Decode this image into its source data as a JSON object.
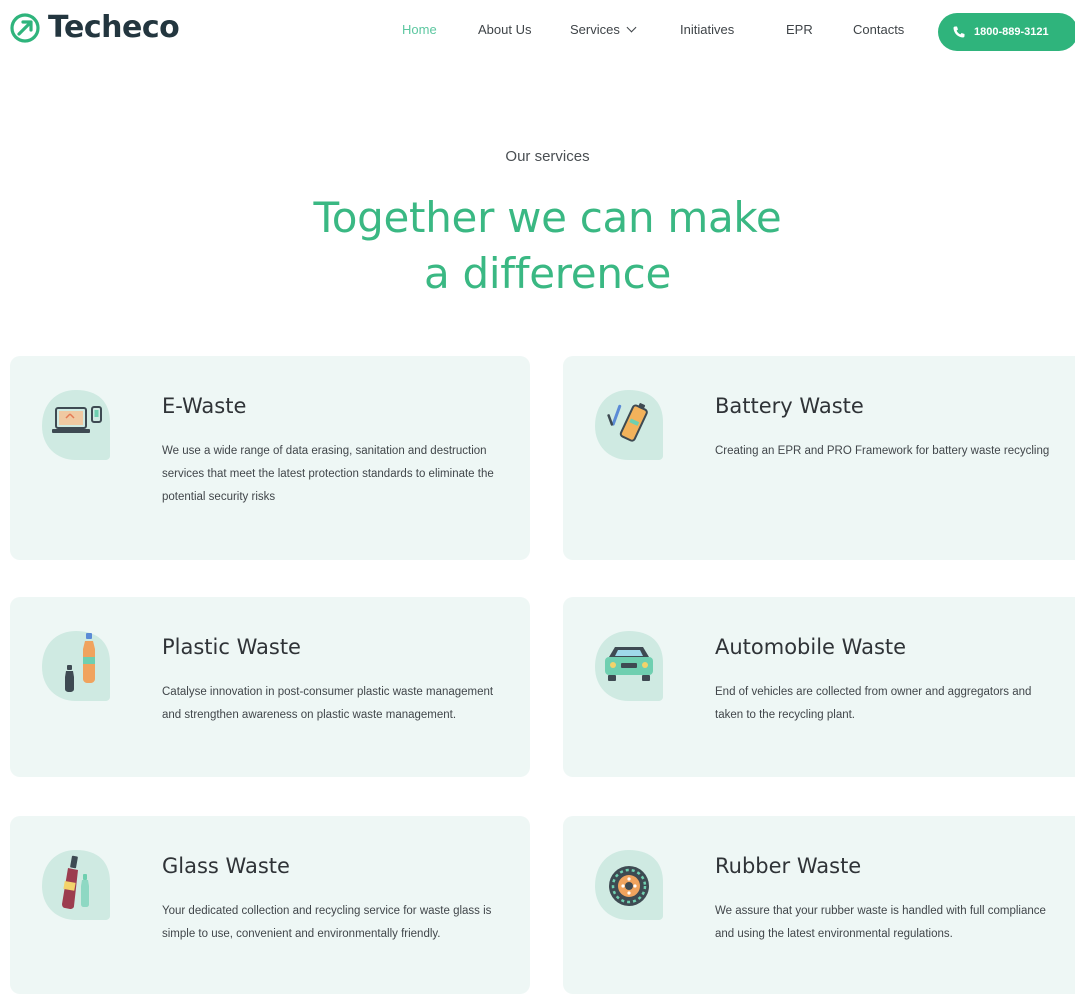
{
  "brand": {
    "name": "Techeco",
    "logo_icon": "recycle-arrow-logo",
    "color": "#2fb47c"
  },
  "nav": {
    "items": [
      {
        "label": "Home",
        "active": true
      },
      {
        "label": "About Us"
      },
      {
        "label": "Services",
        "has_dropdown": true
      },
      {
        "label": "Initiatives"
      },
      {
        "label": "EPR"
      },
      {
        "label": "Contacts"
      }
    ],
    "phone": {
      "label": "1800-889-3121",
      "icon": "phone-icon"
    }
  },
  "section": {
    "eyebrow": "Our services",
    "headline_line1": "Together we can make",
    "headline_line2": "a difference"
  },
  "services": [
    {
      "title": "E-Waste",
      "icon": "laptop-phone-icon",
      "description": "We use a wide range of data erasing, sanitation and destruction services that meet the latest protection standards to eliminate the potential security risks"
    },
    {
      "title": "Battery Waste",
      "icon": "battery-icon",
      "description": "Creating an EPR and PRO Framework for battery waste recycling"
    },
    {
      "title": "Plastic Waste",
      "icon": "plastic-bottle-icon",
      "description": "Catalyse innovation in post-consumer plastic waste management and strengthen awareness on plastic waste management."
    },
    {
      "title": "Automobile Waste",
      "icon": "car-icon",
      "description": "End of vehicles are collected from owner and aggregators and taken to the recycling plant."
    },
    {
      "title": "Glass Waste",
      "icon": "glass-bottle-icon",
      "description": "Your dedicated collection and recycling service for waste glass is simple to use, convenient and environmentally friendly."
    },
    {
      "title": "Rubber Waste",
      "icon": "tire-icon",
      "description": "We assure that your rubber waste is handled with full compliance and using the latest environmental regulations."
    }
  ]
}
